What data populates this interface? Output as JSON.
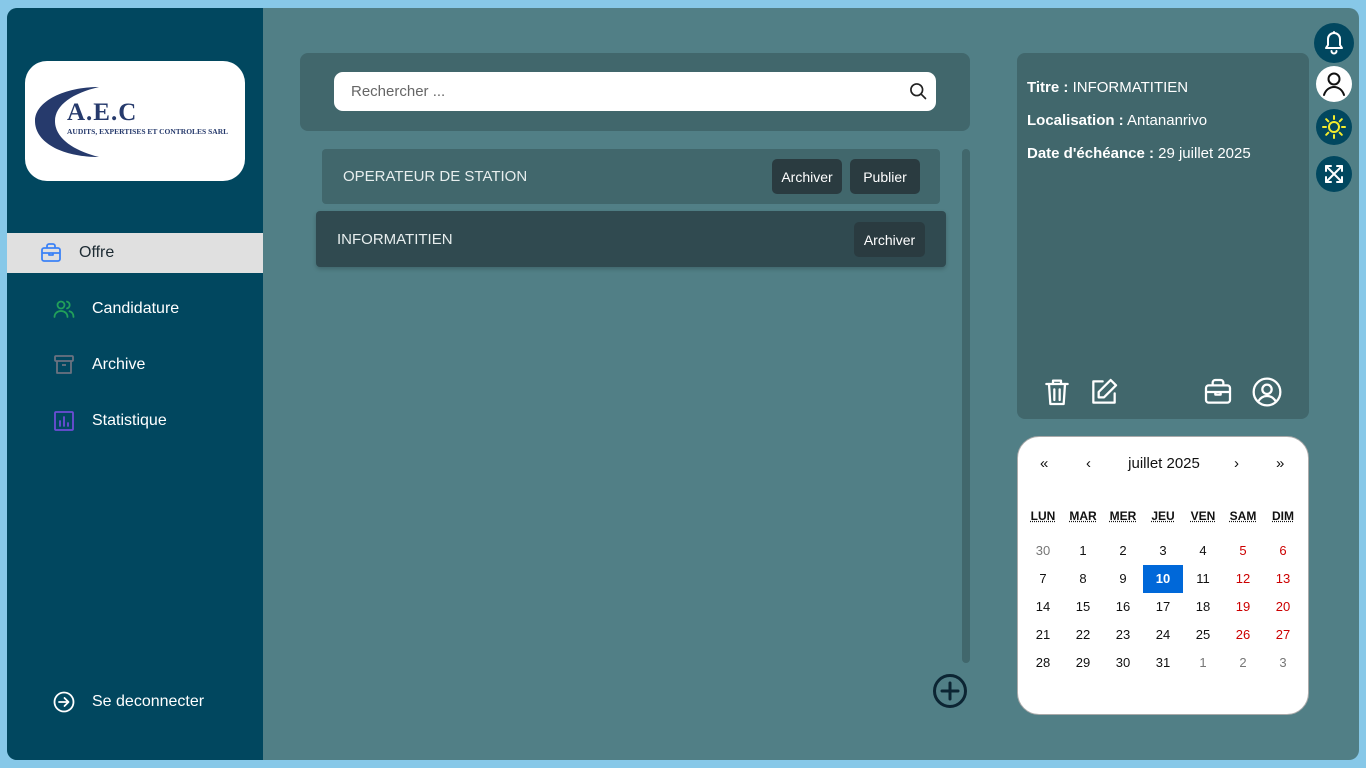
{
  "logo": {
    "abbr": "A.E.C",
    "subtitle": "AUDITS, EXPERTISES ET CONTROLES SARL"
  },
  "sidebar": {
    "items": [
      {
        "label": "Offre",
        "icon": "briefcase-icon",
        "active": true,
        "icon_color": "#3b82f6"
      },
      {
        "label": "Candidature",
        "icon": "users-icon",
        "active": false,
        "icon_color": "#22a05a"
      },
      {
        "label": "Archive",
        "icon": "archive-box-icon",
        "active": false,
        "icon_color": "#6b7280"
      },
      {
        "label": "Statistique",
        "icon": "bar-chart-icon",
        "active": false,
        "icon_color": "#6d4cd6"
      }
    ],
    "logout_label": "Se deconnecter"
  },
  "search": {
    "placeholder": "Rechercher ..."
  },
  "jobs": [
    {
      "title": "OPERATEUR DE STATION",
      "archive_label": "Archiver",
      "publish_label": "Publier"
    },
    {
      "title": "INFORMATITIEN",
      "archive_label": "Archiver"
    }
  ],
  "detail": {
    "title_label": "Titre :",
    "title_value": "INFORMATITIEN",
    "location_label": "Localisation :",
    "location_value": "Antananrivo",
    "deadline_label": "Date d'échéance :",
    "deadline_value": "29 juillet 2025"
  },
  "calendar": {
    "month_label": "juillet 2025",
    "nav": {
      "prev_year": "«",
      "prev_month": "‹",
      "next_month": "›",
      "next_year": "»"
    },
    "weekdays": [
      "LUN",
      "MAR",
      "MER",
      "JEU",
      "VEN",
      "SAM",
      "DIM"
    ],
    "weeks": [
      [
        "30",
        "1",
        "2",
        "3",
        "4",
        "5",
        "6"
      ],
      [
        "7",
        "8",
        "9",
        "10",
        "11",
        "12",
        "13"
      ],
      [
        "14",
        "15",
        "16",
        "17",
        "18",
        "19",
        "20"
      ],
      [
        "21",
        "22",
        "23",
        "24",
        "25",
        "26",
        "27"
      ],
      [
        "28",
        "29",
        "30",
        "31",
        "1",
        "2",
        "3"
      ]
    ],
    "today": "10",
    "weekend_color": "#cc0000",
    "today_color": "#0068d9"
  },
  "colors": {
    "sidebar_bg": "#01475f",
    "main_bg": "#517f86",
    "panel_bg": "#41676c"
  }
}
